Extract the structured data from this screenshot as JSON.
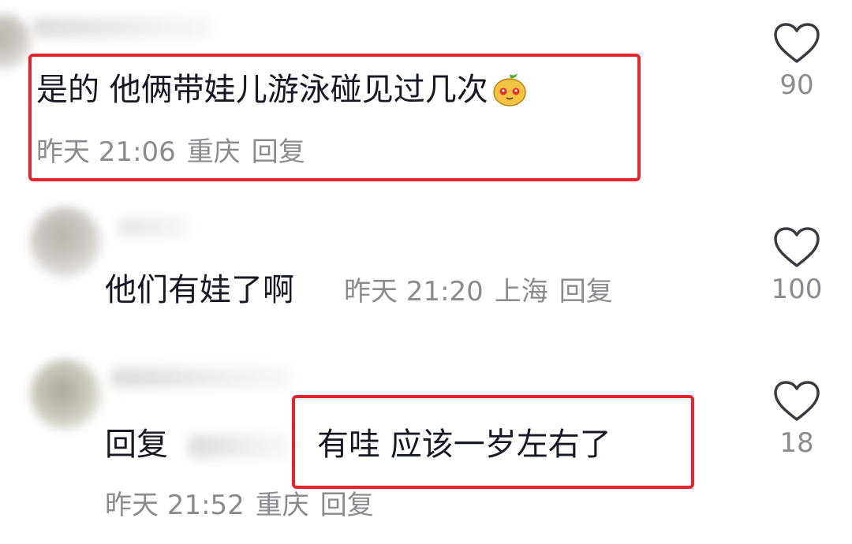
{
  "comments": [
    {
      "text": "是的 他俩带娃儿游泳碰见过几次",
      "emoji": "pear-face-emoji",
      "time": "昨天 21:06",
      "location": "重庆",
      "reply_label": "回复",
      "likes": "90"
    },
    {
      "text": "他们有娃了啊",
      "time": "昨天 21:20",
      "location": "上海",
      "reply_label": "回复",
      "likes": "100"
    },
    {
      "reply_prefix": "回复",
      "text": "有哇 应该一岁左右了",
      "time": "昨天 21:52",
      "location": "重庆",
      "reply_label": "回复",
      "likes": "18"
    }
  ],
  "colors": {
    "highlight": "#e3242b",
    "meta": "#8a8b91",
    "text": "#161823"
  },
  "icons": {
    "like": "heart-outline-icon"
  }
}
